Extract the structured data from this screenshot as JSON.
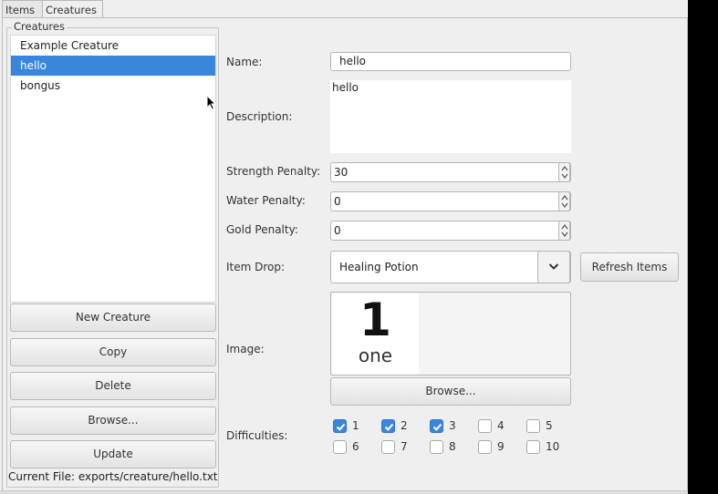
{
  "tabs": [
    {
      "label": "Items"
    },
    {
      "label": "Creatures"
    }
  ],
  "creatures_group": {
    "title": "Creatures",
    "items": [
      {
        "label": "Example Creature"
      },
      {
        "label": "hello"
      },
      {
        "label": "bongus"
      }
    ],
    "selected_index": 1,
    "buttons": {
      "new": "New Creature",
      "copy": "Copy",
      "delete": "Delete",
      "browse": "Browse...",
      "update": "Update"
    },
    "current_file": "Current File: exports/creature/hello.txt"
  },
  "form": {
    "name_label": "Name:",
    "name_value": "hello",
    "description_label": "Description:",
    "description_value": "hello",
    "strength_label": "Strength Penalty:",
    "strength_value": "30",
    "water_label": "Water Penalty:",
    "water_value": "0",
    "gold_label": "Gold Penalty:",
    "gold_value": "0",
    "item_drop_label": "Item Drop:",
    "item_drop_value": "Healing Potion",
    "refresh_label": "Refresh Items",
    "image_label": "Image:",
    "image_big_text": "1",
    "image_word": "one",
    "image_browse_label": "Browse...",
    "difficulties_label": "Difficulties:",
    "difficulties": [
      {
        "label": "1",
        "checked": true
      },
      {
        "label": "2",
        "checked": true
      },
      {
        "label": "3",
        "checked": true
      },
      {
        "label": "4",
        "checked": false
      },
      {
        "label": "5",
        "checked": false
      },
      {
        "label": "6",
        "checked": false
      },
      {
        "label": "7",
        "checked": false
      },
      {
        "label": "8",
        "checked": false
      },
      {
        "label": "9",
        "checked": false
      },
      {
        "label": "10",
        "checked": false
      }
    ]
  },
  "icons": {
    "cursor": "mouse-pointer-icon",
    "spin": "spin-arrows-icon",
    "dropdown": "chevron-down-icon",
    "check": "checkmark-icon"
  },
  "colors": {
    "accent": "#3a86de"
  }
}
